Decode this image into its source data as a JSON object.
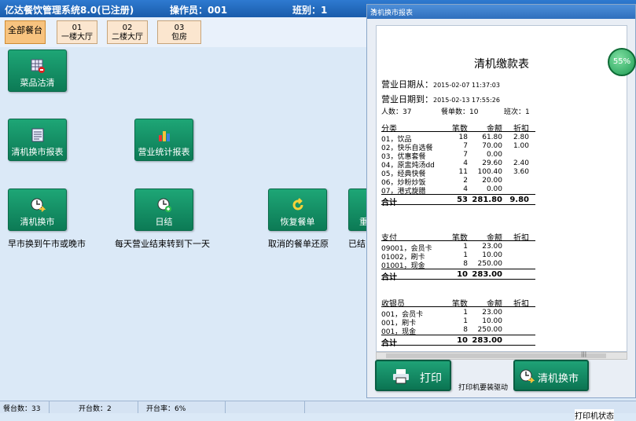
{
  "titlebar": {
    "app_title": "亿达餐饮管理系统8.0(已注册)",
    "operator": "操作员：001",
    "shift": "班别：1"
  },
  "table_tabs": [
    {
      "label": "全部餐台"
    },
    {
      "label": "01\n一楼大厅"
    },
    {
      "label": "02\n二楼大厅"
    },
    {
      "label": "03\n包房"
    }
  ],
  "functions": {
    "dish_sellout": {
      "label": "菜品沽清"
    },
    "shift_report": {
      "label": "清机换市报表"
    },
    "sales_report": {
      "label": "营业统计报表"
    },
    "shift_change": {
      "label": "清机换市",
      "desc": "早市换到午市或晚市"
    },
    "day_close": {
      "label": "日结",
      "desc": "每天营业结束转到下一天"
    },
    "restore_order": {
      "label": "恢复餐单",
      "desc": "取消的餐单还原"
    },
    "partial": {
      "label": "重",
      "desc": "已结"
    }
  },
  "statusbar": {
    "total_tables": "餐台数：33",
    "open_tables": "开台数：2",
    "open_rate": "开台率：6%"
  },
  "report_window": {
    "title": "清机换市报表",
    "close": "×",
    "report_title": "清机缴款表",
    "date_from_label": "营业日期从：",
    "date_from": "2015-02-07 11:37:03",
    "date_to_label": "营业日期到：",
    "date_to": "2015-02-13 17:55:26",
    "persons": "人数：37",
    "orders": "餐单数：10",
    "shift": "班次：1",
    "badge": "55%",
    "category": {
      "headers": [
        "分类",
        "笔数",
        "金额",
        "折扣"
      ],
      "rows": [
        [
          "01，饮品",
          "18",
          "61.80",
          "2.80"
        ],
        [
          "02，快乐自选餐",
          "7",
          "70.00",
          "1.00"
        ],
        [
          "03，优惠套餐",
          "7",
          "0.00",
          ""
        ],
        [
          "04，原盅炖汤dd",
          "4",
          "29.60",
          "2.40"
        ],
        [
          "05，经典快餐",
          "11",
          "100.40",
          "3.60"
        ],
        [
          "06，炒粉炒饭",
          "2",
          "20.00",
          ""
        ],
        [
          "07，港式旋腊",
          "4",
          "0.00",
          ""
        ]
      ],
      "total": [
        "合计",
        "53",
        "281.80",
        "9.80"
      ]
    },
    "payment": {
      "headers": [
        "支付",
        "笔数",
        "金额",
        "折扣"
      ],
      "rows": [
        [
          "09001，会员卡",
          "1",
          "23.00",
          ""
        ],
        [
          "01002，刷卡",
          "1",
          "10.00",
          ""
        ],
        [
          "01001，现金",
          "8",
          "250.00",
          ""
        ]
      ],
      "total": [
        "合计",
        "10",
        "283.00",
        ""
      ]
    },
    "cashier": {
      "headers": [
        "收银员",
        "笔数",
        "金额",
        "折扣"
      ],
      "rows": [
        [
          "001，会员卡",
          "1",
          "23.00",
          ""
        ],
        [
          "001，刷卡",
          "1",
          "10.00",
          ""
        ],
        [
          "001，现金",
          "8",
          "250.00",
          ""
        ]
      ],
      "total": [
        "合计",
        "10",
        "283.00",
        ""
      ]
    },
    "scroll_grip": "|||",
    "print_label": "打印",
    "print_hint": "打印机要装驱动",
    "shift_change_label": "清机换市",
    "printer_status": "打印机状态"
  },
  "colors": {
    "button_green": "#0c7a55",
    "title_blue": "#1a5cab",
    "tab_active": "#f7c37f"
  }
}
